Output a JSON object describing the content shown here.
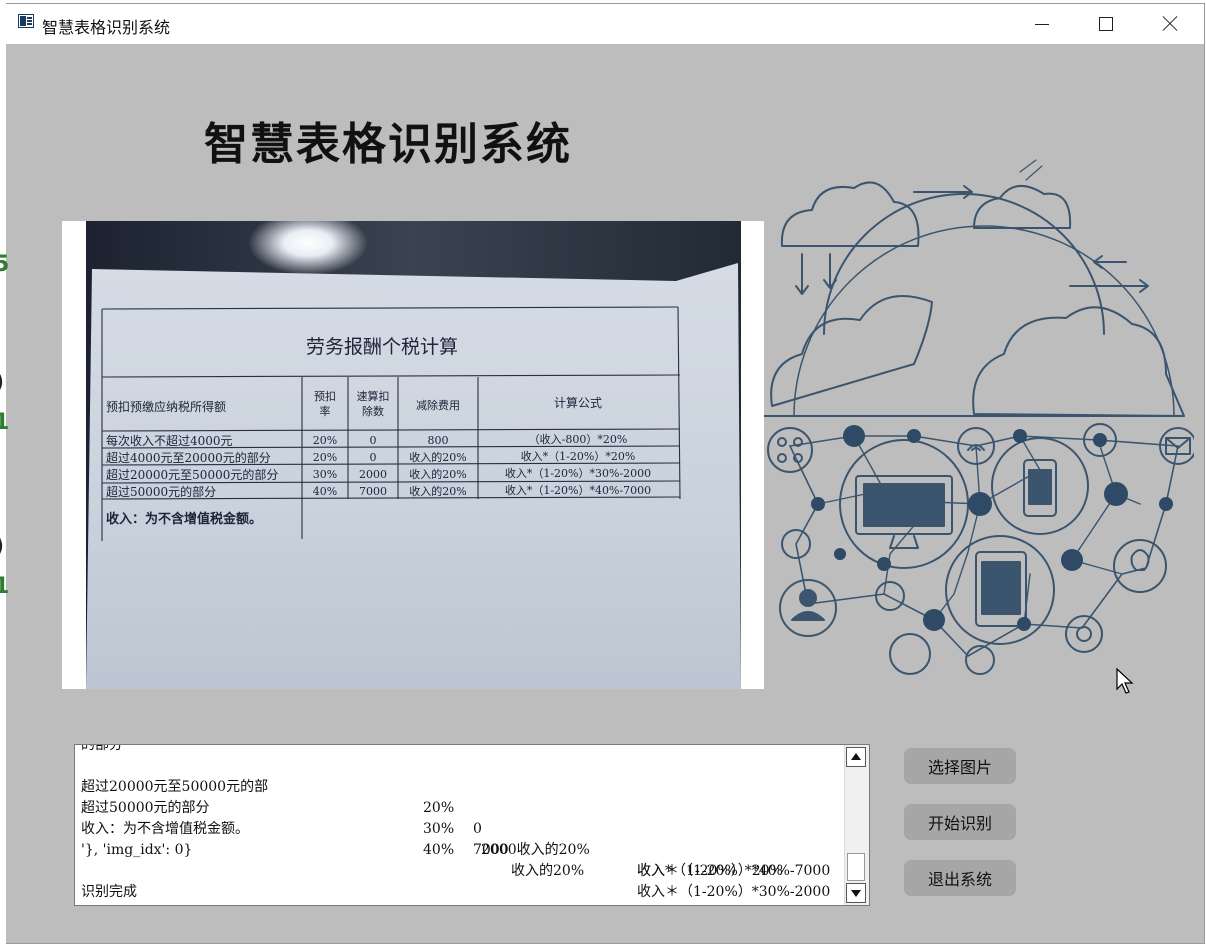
{
  "window": {
    "title": "智慧表格识别系统",
    "controls": {
      "minimize": "minimize",
      "maximize": "maximize",
      "close": "close"
    }
  },
  "header": {
    "title": "智慧表格识别系统"
  },
  "photo": {
    "table_title": "劳务报酬个税计算",
    "headers": [
      "预扣预缴应纳税所得额",
      "预扣率",
      "速算扣除数",
      "减除费用",
      "计算公式"
    ],
    "header_lines": {
      "rate": [
        "预扣",
        "率"
      ],
      "deduction": [
        "速算扣",
        "除数"
      ]
    },
    "rows": [
      [
        "每次收入不超过4000元",
        "20%",
        "0",
        "800",
        "（收入-800）*20%"
      ],
      [
        "超过4000元至20000元的部分",
        "20%",
        "0",
        "收入的20%",
        "收入*（1-20%）*20%"
      ],
      [
        "超过20000元至50000元的部分",
        "30%",
        "2000",
        "收入的20%",
        "收入*（1-20%）*30%-2000"
      ],
      [
        "超过50000元的部分",
        "40%",
        "7000",
        "收入的20%",
        "收入*（1-20%）*40%-7000"
      ]
    ],
    "note": "收入：为不含增值税金额。"
  },
  "output": {
    "lines": [
      {
        "c1": "的部分",
        "c2": "",
        "c3": "",
        "c4": "",
        "c5": ""
      },
      {
        "c1": "超过20000元至50000元的部",
        "c2": "20%",
        "c3": "0",
        "c4": "2000收入的20%",
        "c5": "收入*（1-20%）*20%"
      },
      {
        "c1": "超过50000元的部分",
        "c2": "30%",
        "c3": "7000",
        "c4": "收入的20%",
        "c5": "收入＊（1-20%）*30%-2000"
      },
      {
        "c1": "收入：为不含增值税金额。",
        "c2": "40%",
        "c3": "",
        "c4": "",
        "c5": "收入＊（1-20%）*40%-7000"
      },
      {
        "c1": "",
        "c2": "",
        "c3": "",
        "c4": "",
        "c5": ""
      },
      {
        "c1": "'}, 'img_idx': 0}",
        "c2": "",
        "c3": "",
        "c4": "",
        "c5": ""
      },
      {
        "c1": "",
        "c2": "",
        "c3": "",
        "c4": "",
        "c5": ""
      },
      {
        "c1": "识别完成",
        "c2": "",
        "c3": "",
        "c4": "",
        "c5": ""
      }
    ]
  },
  "buttons": {
    "select": "选择图片",
    "start": "开始识别",
    "exit": "退出系统"
  },
  "edge_fragments": [
    {
      "text": "5",
      "color": "#2e7d32"
    },
    {
      "text": ")",
      "color": "#222222"
    },
    {
      "text": "1",
      "color": "#2e7d32"
    },
    {
      "text": ")",
      "color": "#222222"
    },
    {
      "text": "1",
      "color": "#2e7d32"
    }
  ],
  "colors": {
    "window_bg": "#bdbdbd",
    "button_bg": "#a6a6a6",
    "illustration_stroke": "#2e4a66"
  }
}
